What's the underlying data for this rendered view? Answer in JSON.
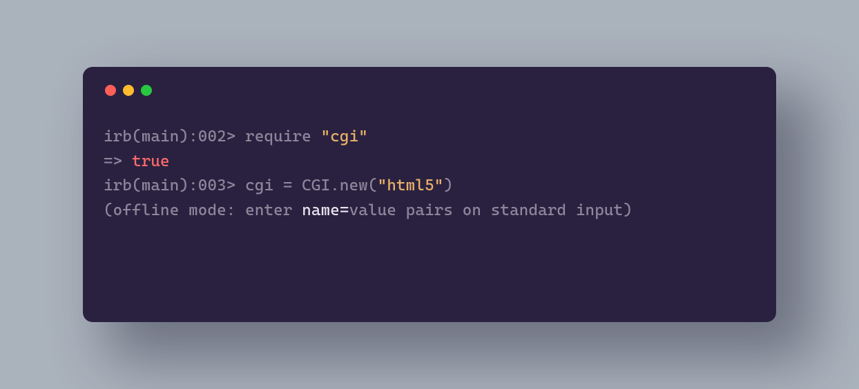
{
  "window": {
    "traffic_light_colors": {
      "red": "#ff5f57",
      "yellow": "#febc2e",
      "green": "#28c840"
    },
    "background": "#2a2140"
  },
  "lines": {
    "l1": {
      "prompt": "irb(main):002> ",
      "cmd_pre": "require ",
      "str": "\"cgi\""
    },
    "l2": {
      "arrow": "=> ",
      "value": "true"
    },
    "l3": {
      "prompt": "irb(main):003> ",
      "cmd_pre": "cgi = CGI.new(",
      "str": "\"html5\"",
      "cmd_post": ")"
    },
    "l4": {
      "pre": "(offline mode: enter ",
      "hl": "name=",
      "post": "value pairs on standard input)"
    }
  }
}
